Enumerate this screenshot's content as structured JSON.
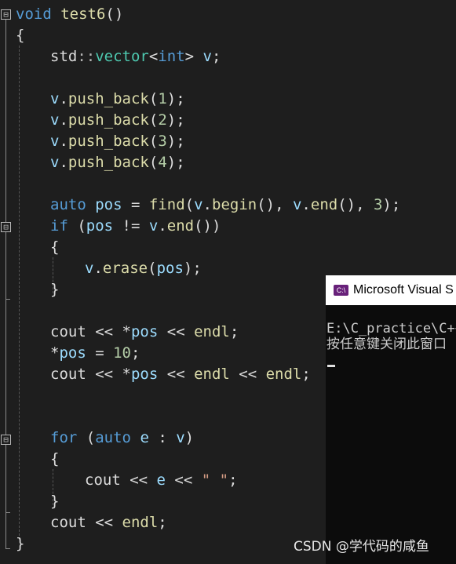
{
  "code": {
    "l1": [
      "void",
      " ",
      "test6",
      "()"
    ],
    "l2": "{",
    "l3": [
      "std",
      "::",
      "vector",
      "<",
      "int",
      ">",
      " ",
      "v",
      ";"
    ],
    "l5": [
      "v",
      ".",
      "push_back",
      "(",
      "1",
      ");"
    ],
    "l6": [
      "v",
      ".",
      "push_back",
      "(",
      "2",
      ");"
    ],
    "l7": [
      "v",
      ".",
      "push_back",
      "(",
      "3",
      ");"
    ],
    "l8": [
      "v",
      ".",
      "push_back",
      "(",
      "4",
      ");"
    ],
    "l10": [
      "auto",
      " ",
      "pos",
      " = ",
      "find",
      "(",
      "v",
      ".",
      "begin",
      "(), ",
      "v",
      ".",
      "end",
      "(), ",
      "3",
      ");"
    ],
    "l11": [
      "if",
      " (",
      "pos",
      " != ",
      "v",
      ".",
      "end",
      "())"
    ],
    "l12": "{",
    "l13": [
      "v",
      ".",
      "erase",
      "(",
      "pos",
      ");"
    ],
    "l14": "}",
    "l16": [
      "cout",
      " << ",
      "*",
      "pos",
      " << ",
      "endl",
      ";"
    ],
    "l17": [
      "*",
      "pos",
      " = ",
      "10",
      ";"
    ],
    "l18": [
      "cout",
      " << ",
      "*",
      "pos",
      " << ",
      "endl",
      " << ",
      "endl",
      ";"
    ],
    "l21": [
      "for",
      " (",
      "auto",
      " ",
      "e",
      " : ",
      "v",
      ")"
    ],
    "l22": "{",
    "l23": [
      "cout",
      " << ",
      "e",
      " << ",
      "\" \"",
      ";"
    ],
    "l24": "}",
    "l25": [
      "cout",
      " << ",
      "endl",
      ";"
    ],
    "l26": "}"
  },
  "fold": {
    "symbol": "⊟"
  },
  "console": {
    "title": "Microsoft Visual S",
    "icon": "C:\\",
    "path_line": "E:\\C_practice\\C++",
    "prompt_line": "按任意键关闭此窗口"
  },
  "watermark": "CSDN @学代码的咸鱼"
}
